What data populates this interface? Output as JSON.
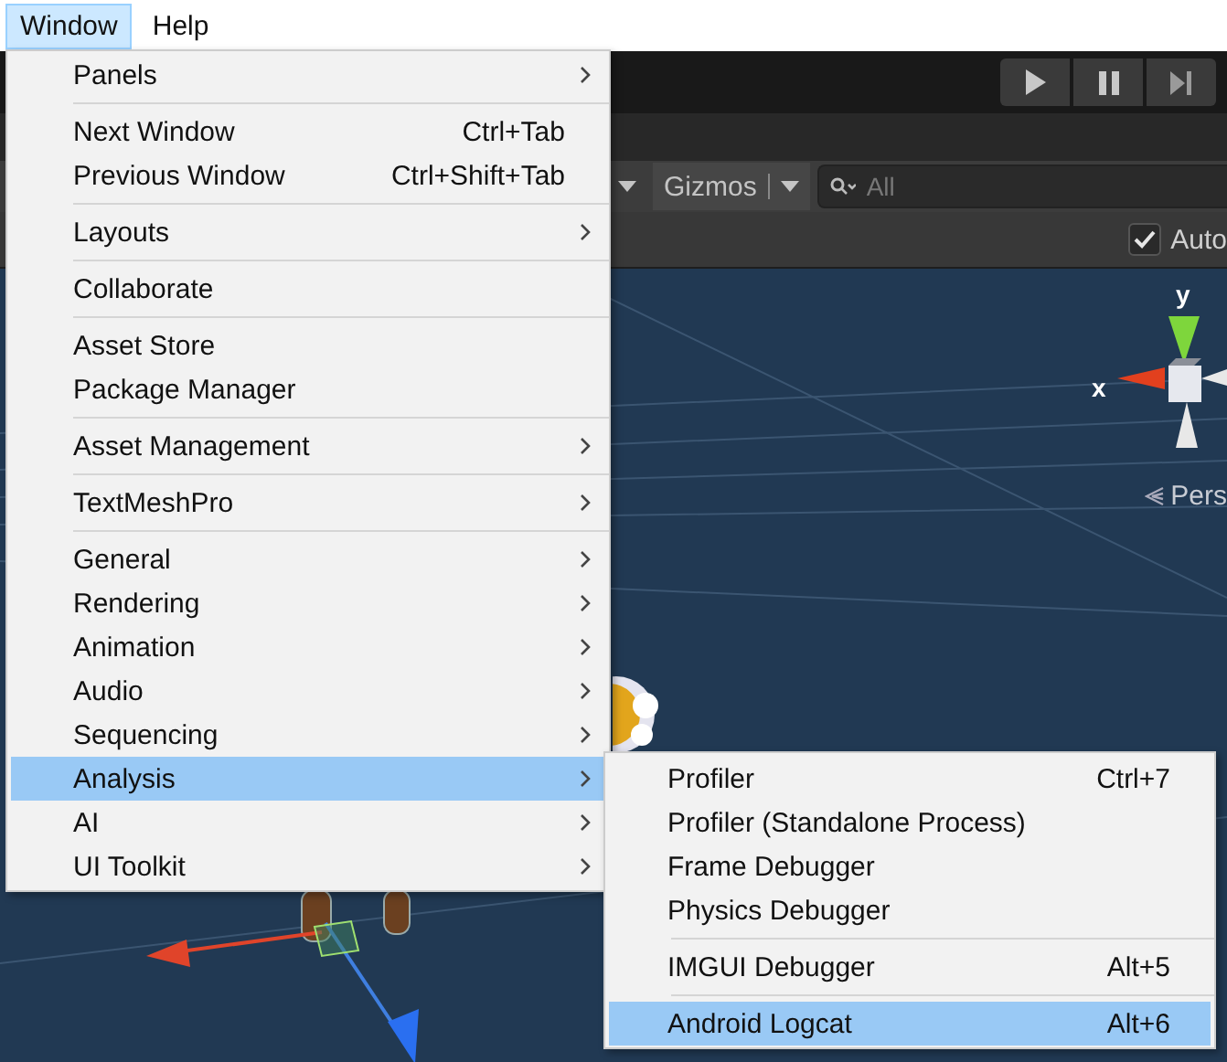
{
  "menubar": [
    {
      "label": "Window",
      "selected": true
    },
    {
      "label": "Help",
      "selected": false
    }
  ],
  "toolbar": {
    "gizmos": "Gizmos",
    "search": {
      "placeholder": "All"
    },
    "auto": {
      "label": "Auto",
      "checked": true
    }
  },
  "scene": {
    "axis_y": "y",
    "axis_x": "x",
    "projection": "Pers"
  },
  "menu": {
    "groups": [
      [
        {
          "label": "Panels",
          "submenu": true,
          "selected": false
        }
      ],
      [
        {
          "label": "Next Window",
          "shortcut": "Ctrl+Tab",
          "submenu": false,
          "selected": false
        },
        {
          "label": "Previous Window",
          "shortcut": "Ctrl+Shift+Tab",
          "submenu": false,
          "selected": false
        }
      ],
      [
        {
          "label": "Layouts",
          "submenu": true,
          "selected": false
        }
      ],
      [
        {
          "label": "Collaborate",
          "submenu": false,
          "selected": false
        }
      ],
      [
        {
          "label": "Asset Store",
          "submenu": false,
          "selected": false
        },
        {
          "label": "Package Manager",
          "submenu": false,
          "selected": false
        }
      ],
      [
        {
          "label": "Asset Management",
          "submenu": true,
          "selected": false
        }
      ],
      [
        {
          "label": "TextMeshPro",
          "submenu": true,
          "selected": false
        }
      ],
      [
        {
          "label": "General",
          "submenu": true,
          "selected": false
        },
        {
          "label": "Rendering",
          "submenu": true,
          "selected": false
        },
        {
          "label": "Animation",
          "submenu": true,
          "selected": false
        },
        {
          "label": "Audio",
          "submenu": true,
          "selected": false
        },
        {
          "label": "Sequencing",
          "submenu": true,
          "selected": false
        },
        {
          "label": "Analysis",
          "submenu": true,
          "selected": true
        },
        {
          "label": "AI",
          "submenu": true,
          "selected": false
        },
        {
          "label": "UI Toolkit",
          "submenu": true,
          "selected": false
        }
      ]
    ]
  },
  "submenu": {
    "groups": [
      [
        {
          "label": "Profiler",
          "shortcut": "Ctrl+7",
          "selected": false
        },
        {
          "label": "Profiler (Standalone Process)",
          "selected": false
        },
        {
          "label": "Frame Debugger",
          "selected": false
        },
        {
          "label": "Physics Debugger",
          "selected": false
        }
      ],
      [
        {
          "label": "IMGUI Debugger",
          "shortcut": "Alt+5",
          "selected": false
        }
      ],
      [
        {
          "label": "Android Logcat",
          "shortcut": "Alt+6",
          "selected": true
        }
      ]
    ]
  }
}
